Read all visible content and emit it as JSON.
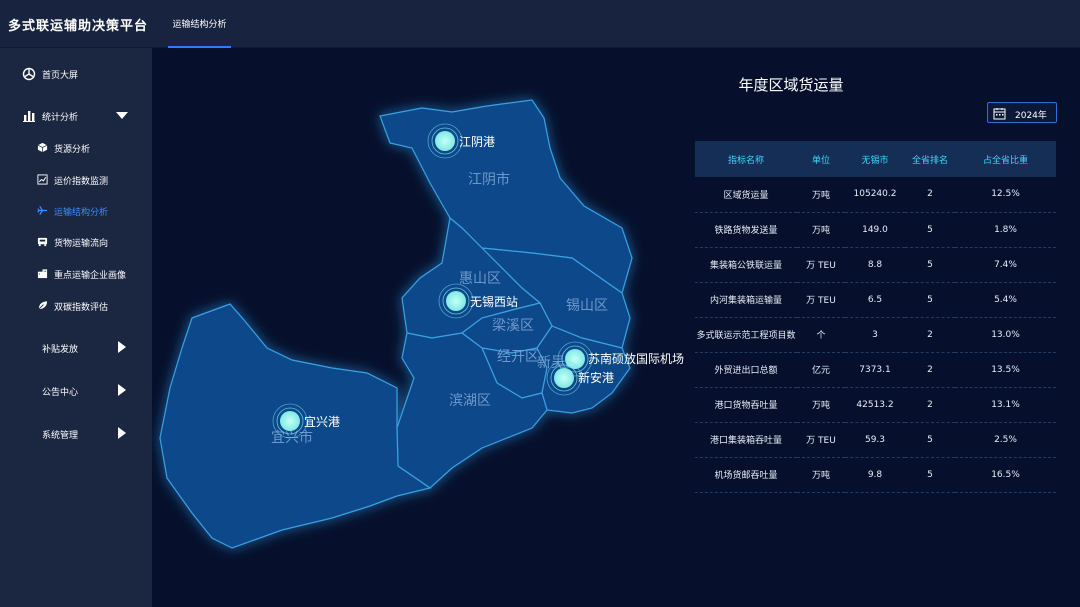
{
  "app": {
    "title": "多式联运辅助决策平台",
    "active_tab": "运输结构分析"
  },
  "sidebar": {
    "items": [
      {
        "label": "首页大屏",
        "icon": "dashboard-icon",
        "type": "top"
      },
      {
        "label": "统计分析",
        "icon": "chart-bar-icon",
        "type": "top-expanded"
      },
      {
        "label": "货源分析",
        "icon": "cube-icon",
        "type": "sub"
      },
      {
        "label": "运价指数监测",
        "icon": "line-chart-icon",
        "type": "sub"
      },
      {
        "label": "运输结构分析",
        "icon": "airplane-icon",
        "type": "sub-active"
      },
      {
        "label": "货物运输流向",
        "icon": "truck-icon",
        "type": "sub"
      },
      {
        "label": "重点运输企业画像",
        "icon": "building-icon",
        "type": "sub"
      },
      {
        "label": "双碳指数评估",
        "icon": "leaf-icon",
        "type": "sub"
      },
      {
        "label": "补贴发放",
        "type": "collapsed"
      },
      {
        "label": "公告中心",
        "type": "collapsed"
      },
      {
        "label": "系统管理",
        "type": "collapsed"
      }
    ]
  },
  "map": {
    "districts": [
      "江阴市",
      "惠山区",
      "锡山区",
      "梁溪区",
      "经开区",
      "滨湖区",
      "宜兴市",
      "新吴区"
    ],
    "markers": [
      "江阴港",
      "无锡西站",
      "苏南硕放国际机场",
      "新安港",
      "宜兴港"
    ]
  },
  "panel": {
    "title": "年度区域货运量",
    "year": "2024年",
    "headers": [
      "指标名称",
      "单位",
      "无锡市",
      "全省排名",
      "占全省比重"
    ],
    "rows": [
      [
        "区域货运量",
        "万吨",
        "105240.2",
        "2",
        "12.5%"
      ],
      [
        "铁路货物发送量",
        "万吨",
        "149.0",
        "5",
        "1.8%"
      ],
      [
        "集装箱公铁联运量",
        "万 TEU",
        "8.8",
        "5",
        "7.4%"
      ],
      [
        "内河集装箱运输量",
        "万 TEU",
        "6.5",
        "5",
        "5.4%"
      ],
      [
        "多式联运示范工程项目数",
        "个",
        "3",
        "2",
        "13.0%"
      ],
      [
        "外贸进出口总额",
        "亿元",
        "7373.1",
        "2",
        "13.5%"
      ],
      [
        "港口货物吞吐量",
        "万吨",
        "42513.2",
        "2",
        "13.1%"
      ],
      [
        "港口集装箱吞吐量",
        "万 TEU",
        "59.3",
        "5",
        "2.5%"
      ],
      [
        "机场货邮吞吐量",
        "万吨",
        "9.8",
        "5",
        "16.5%"
      ]
    ]
  },
  "colors": {
    "accent": "#2f7bff",
    "header_text": "#3fd6ff",
    "map_fill": "#0e4a8a",
    "marker": "#9ef6f0"
  }
}
